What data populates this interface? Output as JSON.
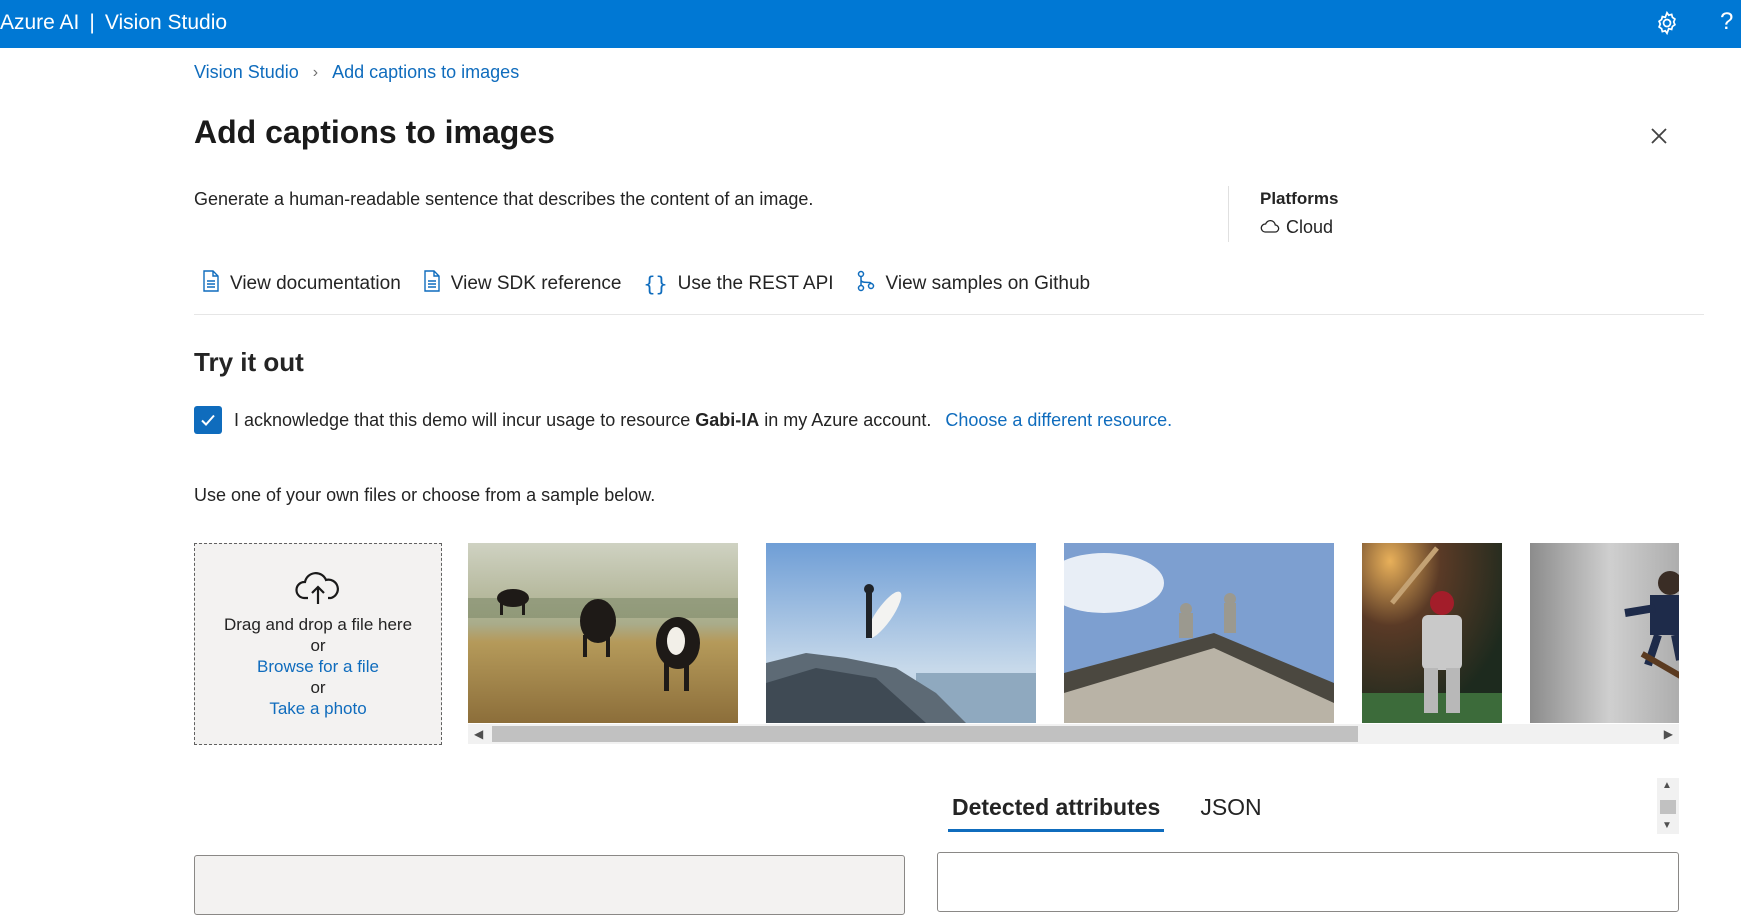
{
  "header": {
    "brand": "Azure AI",
    "separator": "|",
    "app": "Vision Studio"
  },
  "breadcrumb": {
    "root": "Vision Studio",
    "current": "Add captions to images"
  },
  "page": {
    "title": "Add captions to images",
    "description": "Generate a human-readable sentence that describes the content of an image."
  },
  "platforms": {
    "heading": "Platforms",
    "value": "Cloud"
  },
  "links": [
    {
      "label": "View documentation"
    },
    {
      "label": "View SDK reference"
    },
    {
      "label": "Use the REST API"
    },
    {
      "label": "View samples on Github"
    }
  ],
  "try": {
    "heading": "Try it out",
    "ack_prefix": "I acknowledge that this demo will incur usage to resource",
    "resource": "Gabi-IA",
    "ack_suffix": "in my Azure account.",
    "change_link": "Choose a different resource.",
    "acknowledged": true,
    "instructions": "Use one of your own files or choose from a sample below."
  },
  "upload": {
    "line1": "Drag and drop a file here",
    "or1": "or",
    "browse": "Browse for a file",
    "or2": "or",
    "photo": "Take a photo"
  },
  "results": {
    "tabs": [
      "Detected attributes",
      "JSON"
    ],
    "active_tab": 0
  },
  "colors": {
    "brand": "#0078d4",
    "link": "#0f6cbd"
  }
}
